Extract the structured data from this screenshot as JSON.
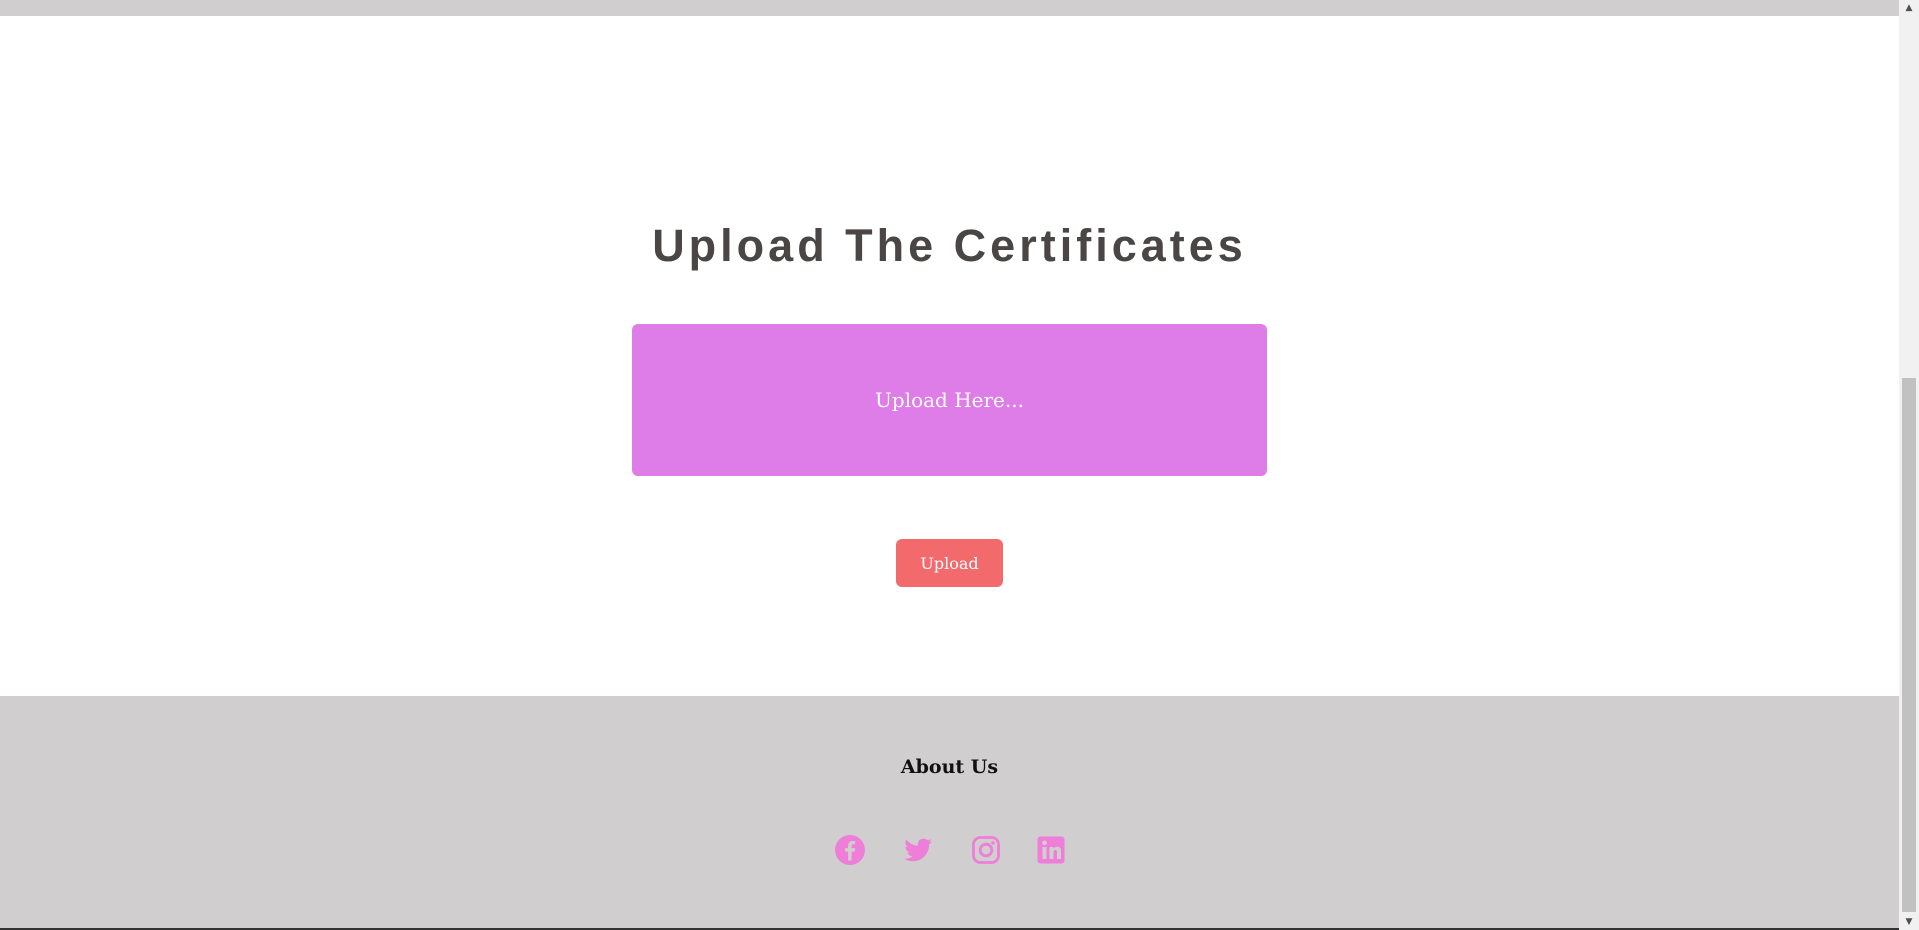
{
  "main": {
    "title": "Upload The Certificates",
    "upload_area_label": "Upload Here...",
    "upload_button_label": "Upload"
  },
  "footer": {
    "heading": "About Us",
    "social": [
      {
        "icon": "facebook-icon"
      },
      {
        "icon": "twitter-icon"
      },
      {
        "icon": "instagram-icon"
      },
      {
        "icon": "linkedin-icon"
      }
    ]
  },
  "colors": {
    "title": "#4a4646",
    "upload_area": "#df7de8",
    "upload_button": "#f26a6c",
    "footer_background": "#d0cecf",
    "social_icon": "#ee7ed8"
  },
  "scrollbar": {
    "up_arrow": "▲",
    "down_arrow": "▼"
  }
}
